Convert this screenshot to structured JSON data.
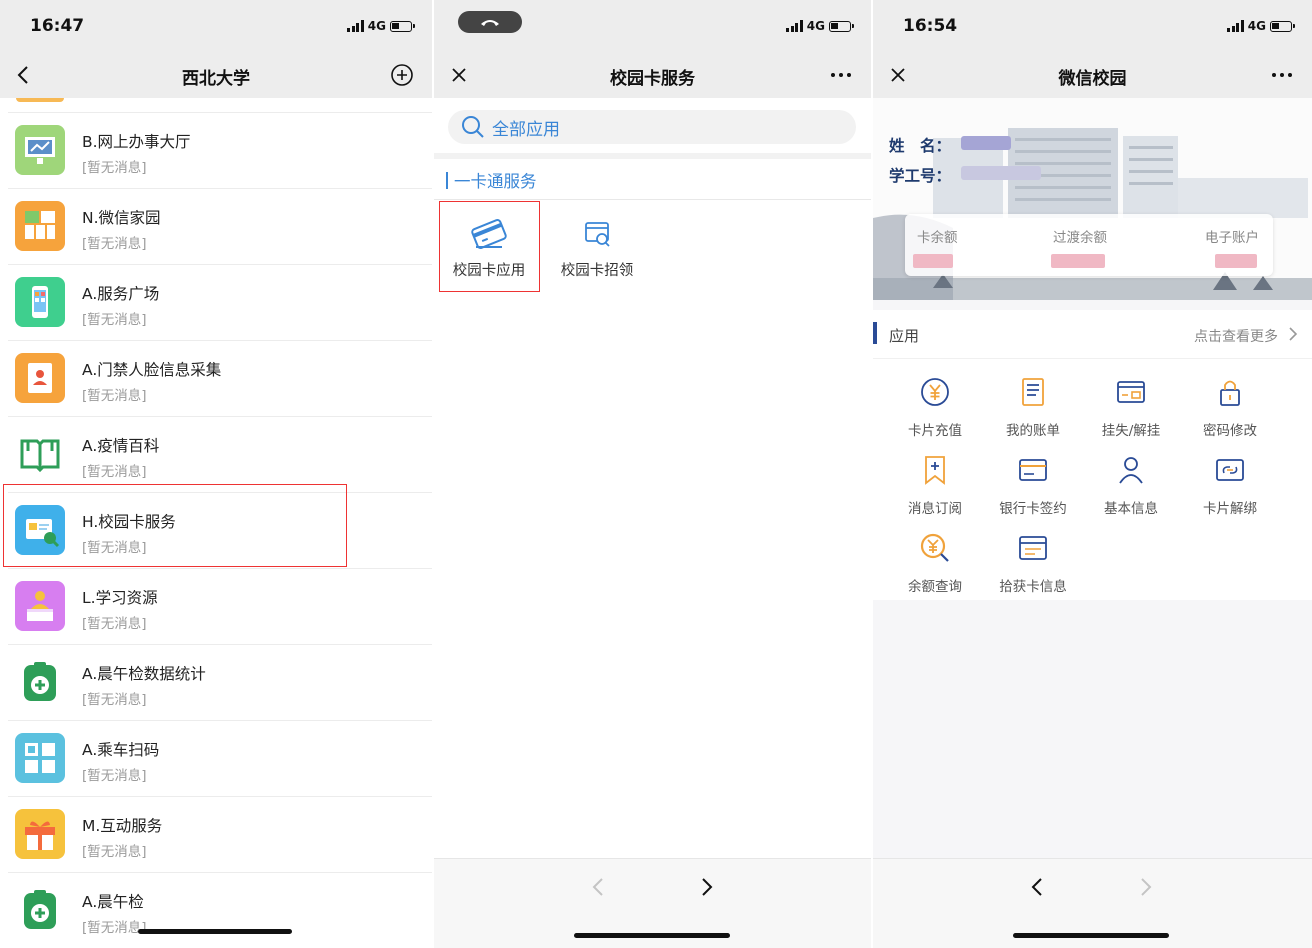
{
  "screen1": {
    "time": "16:47",
    "network": "4G",
    "title": "西北大学",
    "items": [
      {
        "title": "B.网上办事大厅",
        "sub": "[暂无消息]"
      },
      {
        "title": "N.微信家园",
        "sub": "[暂无消息]"
      },
      {
        "title": "A.服务广场",
        "sub": "[暂无消息]"
      },
      {
        "title": "A.门禁人脸信息采集",
        "sub": "[暂无消息]"
      },
      {
        "title": "A.疫情百科",
        "sub": "[暂无消息]"
      },
      {
        "title": "H.校园卡服务",
        "sub": "[暂无消息]"
      },
      {
        "title": "L.学习资源",
        "sub": "[暂无消息]"
      },
      {
        "title": "A.晨午检数据统计",
        "sub": "[暂无消息]"
      },
      {
        "title": "A.乘车扫码",
        "sub": "[暂无消息]"
      },
      {
        "title": "M.互动服务",
        "sub": "[暂无消息]"
      },
      {
        "title": "A.晨午检",
        "sub": "[暂无消息]"
      }
    ]
  },
  "screen2": {
    "network": "4G",
    "title": "校园卡服务",
    "search_label": "全部应用",
    "section_title": "一卡通服务",
    "apps": [
      {
        "label": "校园卡应用"
      },
      {
        "label": "校园卡招领"
      }
    ]
  },
  "screen3": {
    "time": "16:54",
    "network": "4G",
    "title": "微信校园",
    "name_label": "姓　名：",
    "id_label": "学工号：",
    "card_labels": [
      "卡余额",
      "过渡余额",
      "电子账户"
    ],
    "apps_title": "应用",
    "more_label": "点击查看更多",
    "apps": [
      {
        "label": "卡片充值",
        "icon": "yuan-circle-icon"
      },
      {
        "label": "我的账单",
        "icon": "bill-icon"
      },
      {
        "label": "挂失/解挂",
        "icon": "card-lock-icon"
      },
      {
        "label": "密码修改",
        "icon": "padlock-icon"
      },
      {
        "label": "消息订阅",
        "icon": "bookmark-plus-icon"
      },
      {
        "label": "银行卡签约",
        "icon": "bank-card-icon"
      },
      {
        "label": "基本信息",
        "icon": "person-icon"
      },
      {
        "label": "卡片解绑",
        "icon": "unlink-card-icon"
      },
      {
        "label": "余额查询",
        "icon": "yuan-search-icon"
      },
      {
        "label": "拾获卡信息",
        "icon": "found-card-icon"
      }
    ]
  },
  "colors": {
    "accent_blue": "#3a86d6",
    "navy": "#2a4b96",
    "orange": "#f0a23b",
    "highlight_red": "#ee3333"
  }
}
